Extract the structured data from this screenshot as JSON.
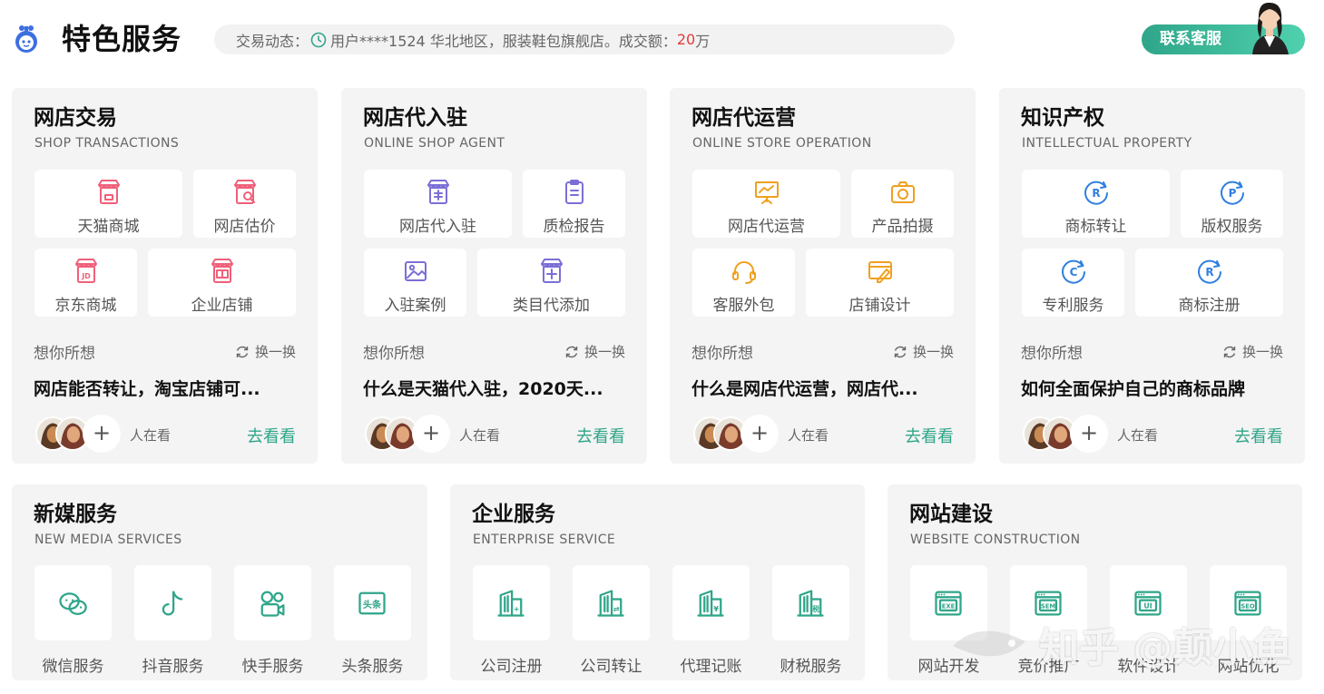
{
  "header": {
    "title": "特色服务",
    "ticker_prefix": "交易动态：",
    "ticker_text": "用户****1524 华北地区，服装鞋包旗舰店。成交额：",
    "ticker_amount": "20",
    "ticker_unit": "万",
    "service_button": "联系客服",
    "accent_color": "#2fa589"
  },
  "top_cards": [
    {
      "title": "网店交易",
      "subtitle": "SHOP TRANSACTIONS",
      "icon_color": "#f0607a",
      "tiles": [
        {
          "label": "天猫商城",
          "icon": "shop-icon"
        },
        {
          "label": "网店估价",
          "icon": "shop-search-icon"
        },
        {
          "label": "京东商城",
          "icon": "jd-shop-icon"
        },
        {
          "label": "企业店铺",
          "icon": "enterprise-shop-icon"
        }
      ],
      "think": "想你所想",
      "refresh": "换一换",
      "question": "网店能否转让，淘宝店铺可...",
      "watching": "人在看",
      "go": "去看看"
    },
    {
      "title": "网店代入驻",
      "subtitle": "ONLINE SHOP AGENT",
      "icon_color": "#7b6fd6",
      "tiles": [
        {
          "label": "网店代入驻",
          "icon": "shop-agent-icon"
        },
        {
          "label": "质检报告",
          "icon": "clipboard-icon"
        },
        {
          "label": "入驻案例",
          "icon": "image-icon"
        },
        {
          "label": "类目代添加",
          "icon": "shop-add-icon"
        }
      ],
      "think": "想你所想",
      "refresh": "换一换",
      "question": "什么是天猫代入驻，2020天...",
      "watching": "人在看",
      "go": "去看看"
    },
    {
      "title": "网店代运营",
      "subtitle": "ONLINE STORE OPERATION",
      "icon_color": "#f0a020",
      "tiles": [
        {
          "label": "网店代运营",
          "icon": "presentation-icon"
        },
        {
          "label": "产品拍摄",
          "icon": "camera-icon"
        },
        {
          "label": "客服外包",
          "icon": "headset-icon"
        },
        {
          "label": "店铺设计",
          "icon": "design-icon"
        }
      ],
      "think": "想你所想",
      "refresh": "换一换",
      "question": "什么是网店代运营，网店代...",
      "watching": "人在看",
      "go": "去看看"
    },
    {
      "title": "知识产权",
      "subtitle": "INTELLECTUAL PROPERTY",
      "icon_color": "#2f7fe0",
      "tiles": [
        {
          "label": "商标转让",
          "icon": "trademark-transfer-icon",
          "letter": "R"
        },
        {
          "label": "版权服务",
          "icon": "copyright-icon",
          "letter": "P"
        },
        {
          "label": "专利服务",
          "icon": "patent-icon",
          "letter": "C"
        },
        {
          "label": "商标注册",
          "icon": "trademark-register-icon",
          "letter": "R"
        }
      ],
      "think": "想你所想",
      "refresh": "换一换",
      "question": "如何全面保护自己的商标品牌",
      "watching": "人在看",
      "go": "去看看"
    }
  ],
  "bottom_cards": [
    {
      "title": "新媒服务",
      "subtitle": "NEW MEDIA SERVICES",
      "tiles": [
        {
          "label": "微信服务",
          "icon": "wechat-icon"
        },
        {
          "label": "抖音服务",
          "icon": "douyin-icon"
        },
        {
          "label": "快手服务",
          "icon": "kuaishou-icon"
        },
        {
          "label": "头条服务",
          "icon": "toutiao-icon",
          "glyph": "头条"
        }
      ]
    },
    {
      "title": "企业服务",
      "subtitle": "ENTERPRISE SERVICE",
      "tiles": [
        {
          "label": "公司注册",
          "icon": "company-register-icon"
        },
        {
          "label": "公司转让",
          "icon": "company-transfer-icon"
        },
        {
          "label": "代理记账",
          "icon": "bookkeeping-icon"
        },
        {
          "label": "财税服务",
          "icon": "tax-icon"
        }
      ]
    },
    {
      "title": "网站建设",
      "subtitle": "WEBSITE CONSTRUCTION",
      "tiles": [
        {
          "label": "网站开发",
          "icon": "exe-window-icon",
          "glyph": "EXE"
        },
        {
          "label": "竞价推广",
          "icon": "sem-window-icon",
          "glyph": "SEM"
        },
        {
          "label": "软件设计",
          "icon": "ui-window-icon",
          "glyph": "UI"
        },
        {
          "label": "网站优化",
          "icon": "seo-window-icon",
          "glyph": "SEO"
        }
      ]
    }
  ],
  "bottom_icon_color": "#2fa589",
  "watermark": "知乎 @颠小鱼"
}
